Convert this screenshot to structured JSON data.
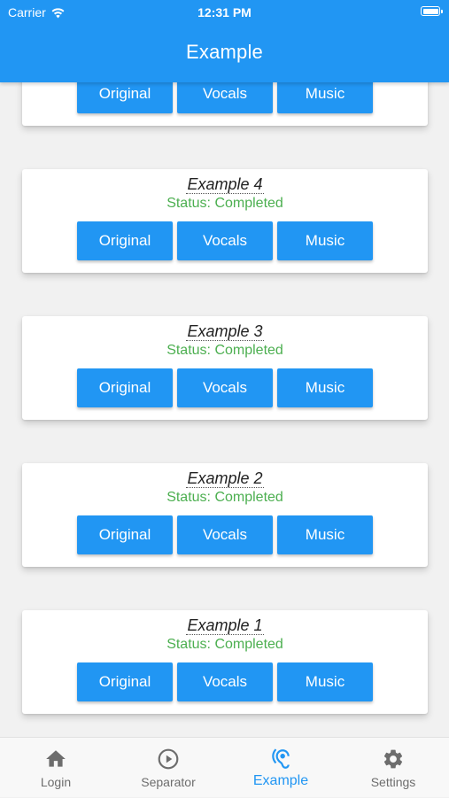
{
  "status_bar": {
    "carrier": "Carrier",
    "time": "12:31 PM"
  },
  "header": {
    "title": "Example"
  },
  "colors": {
    "primary": "#2196f3",
    "status_completed": "#4caf50",
    "tab_inactive": "#6d6d6d"
  },
  "cards": [
    {
      "title": "",
      "status": "",
      "buttons": [
        "Original",
        "Vocals",
        "Music"
      ]
    },
    {
      "title": "Example 4",
      "status": "Status: Completed",
      "buttons": [
        "Original",
        "Vocals",
        "Music"
      ]
    },
    {
      "title": "Example 3",
      "status": "Status: Completed",
      "buttons": [
        "Original",
        "Vocals",
        "Music"
      ]
    },
    {
      "title": "Example 2",
      "status": "Status: Completed",
      "buttons": [
        "Original",
        "Vocals",
        "Music"
      ]
    },
    {
      "title": "Example 1",
      "status": "Status: Completed",
      "buttons": [
        "Original",
        "Vocals",
        "Music"
      ]
    }
  ],
  "tabs": [
    {
      "label": "Login",
      "icon": "home-icon",
      "active": false
    },
    {
      "label": "Separator",
      "icon": "play-circle-icon",
      "active": false
    },
    {
      "label": "Example",
      "icon": "hearing-icon",
      "active": true
    },
    {
      "label": "Settings",
      "icon": "gear-icon",
      "active": false
    }
  ]
}
